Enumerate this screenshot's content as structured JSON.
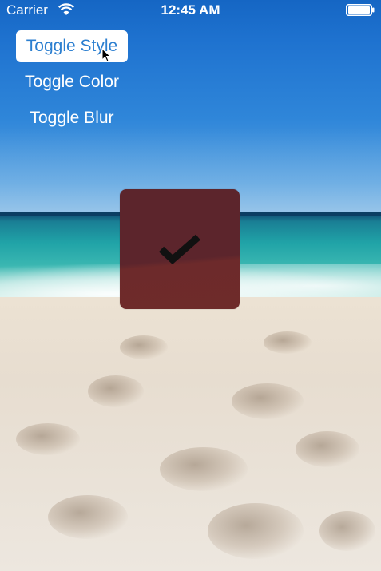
{
  "status_bar": {
    "carrier": "Carrier",
    "time": "12:45 AM",
    "icons": [
      "wifi-icon",
      "battery-icon"
    ]
  },
  "menu": {
    "items": [
      {
        "label": "Toggle Style",
        "selected": true
      },
      {
        "label": "Toggle Color",
        "selected": false
      },
      {
        "label": "Toggle Blur",
        "selected": false
      }
    ]
  },
  "hud": {
    "icon": "checkmark-icon",
    "background_color": "#5c252c"
  },
  "colors": {
    "selected_button_text": "#2c7fd0",
    "button_text": "#ffffff"
  }
}
